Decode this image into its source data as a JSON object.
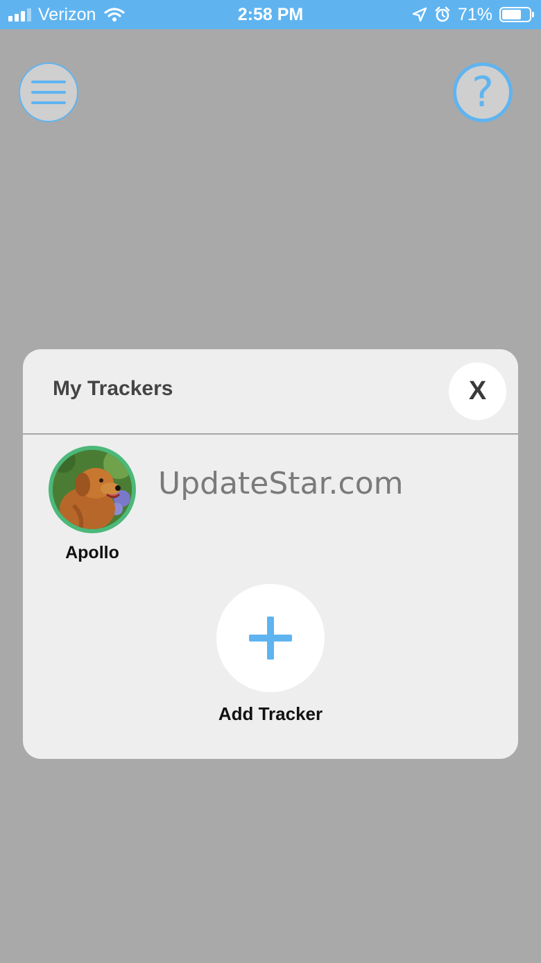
{
  "status_bar": {
    "carrier": "Verizon",
    "time": "2:58 PM",
    "battery_percent": "71%",
    "battery_level": 0.71,
    "icons": [
      "signal-icon",
      "wifi-icon",
      "location-arrow-icon",
      "alarm-icon",
      "battery-icon"
    ],
    "color": "#5fb4f0"
  },
  "header": {
    "menu_icon": "hamburger-menu-icon",
    "help_icon": "question-mark-icon",
    "help_glyph": "?"
  },
  "panel": {
    "title": "My Trackers",
    "close_label": "X",
    "trackers": [
      {
        "name": "Apollo",
        "avatar": "dog-photo",
        "ring_color": "#4cb87a"
      }
    ],
    "add_label": "Add Tracker",
    "add_icon": "plus-icon"
  },
  "watermark": "UpdateStar.com",
  "colors": {
    "accent": "#5fb4f0",
    "overlay": "#a9a9a9",
    "panel": "#eeeeee"
  }
}
